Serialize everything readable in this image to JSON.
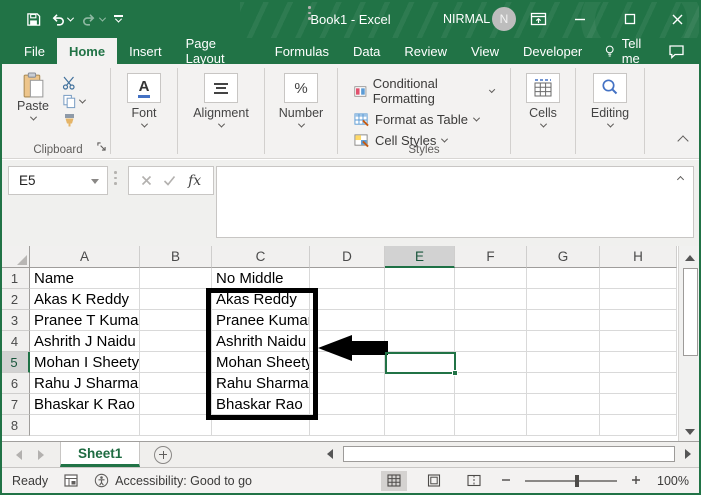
{
  "window": {
    "title": "Book1 - Excel",
    "user_name": "NIRMAL",
    "avatar_initial": "N"
  },
  "tabs": {
    "items": [
      "File",
      "Home",
      "Insert",
      "Page Layout",
      "Formulas",
      "Data",
      "Review",
      "View",
      "Developer"
    ],
    "active": "Home",
    "tell_me": "Tell me"
  },
  "ribbon": {
    "paste_label": "Paste",
    "clipboard_label": "Clipboard",
    "font_label": "Font",
    "font_icon_glyph": "A",
    "alignment_label": "Alignment",
    "number_label": "Number",
    "number_icon_glyph": "%",
    "conditional_formatting": "Conditional Formatting",
    "format_as_table": "Format as Table",
    "cell_styles": "Cell Styles",
    "styles_label": "Styles",
    "cells_label": "Cells",
    "editing_label": "Editing"
  },
  "formula_bar": {
    "name_box": "E5",
    "fx_label": "fx",
    "content": ""
  },
  "grid": {
    "columns": [
      "A",
      "B",
      "C",
      "D",
      "E",
      "F",
      "G",
      "H"
    ],
    "active_cell": "E5",
    "rows": [
      {
        "n": "1",
        "a": "Name",
        "c": "No Middle"
      },
      {
        "n": "2",
        "a": "Akas K Reddy",
        "c": "Akas Reddy"
      },
      {
        "n": "3",
        "a": "Pranee T Kumar",
        "c": "Pranee Kumar"
      },
      {
        "n": "4",
        "a": "Ashrith J Naidu",
        "c": "Ashrith Naidu"
      },
      {
        "n": "5",
        "a": "Mohan I Sheety",
        "c": "Mohan Sheety"
      },
      {
        "n": "6",
        "a": "Rahu J Sharma",
        "c": "Rahu Sharma"
      },
      {
        "n": "7",
        "a": "Bhaskar K Rao",
        "c": "Bhaskar Rao"
      },
      {
        "n": "8",
        "a": "",
        "c": ""
      }
    ]
  },
  "sheet": {
    "tab": "Sheet1"
  },
  "status": {
    "mode": "Ready",
    "accessibility": "Accessibility: Good to go",
    "zoom_level": "100%"
  },
  "colors": {
    "accent": "#217346",
    "selection_box": "#000000",
    "header_highlight": "#d2d2d2"
  }
}
